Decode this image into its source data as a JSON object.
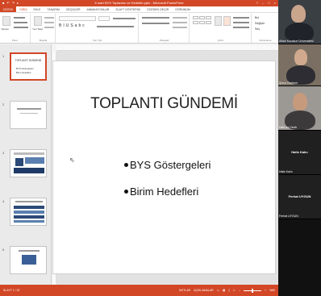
{
  "app": {
    "title": "6 mart BYS Toplantısı ve Hedefler.pptx - Microsoft PowerPoint",
    "qat_icons": [
      "save-icon",
      "undo-icon",
      "redo-icon",
      "start-icon"
    ],
    "window_controls": [
      "?",
      "–",
      "□",
      "×"
    ]
  },
  "ribbon": {
    "tabs": [
      "DOSYA",
      "GİRİŞ",
      "EKLE",
      "TASARIM",
      "GEÇİŞLER",
      "ANİMASYONLAR",
      "SLAYT GÖSTERİSİ",
      "GÖZDEN GEÇİR",
      "GÖRÜNÜM"
    ],
    "active_tab": "GİRİŞ",
    "groups": [
      "Pano",
      "Slaytlar",
      "Yazı Tipi",
      "Paragraf",
      "Çizim",
      "Düzenleme"
    ],
    "paste_label": "Yapıştır",
    "new_slide_label": "Yeni Slayt",
    "find_label": "Bul",
    "replace_label": "Değiştir",
    "select_label": "Seç"
  },
  "thumbnails": [
    {
      "number": "1",
      "title": "TOPLANTI GÜNDEMİ",
      "lines": [
        "BYS Göstergeleri",
        "Birim Hedefleri"
      ]
    },
    {
      "number": "2",
      "title": ""
    },
    {
      "number": "3",
      "title": ""
    },
    {
      "number": "4",
      "title": ""
    },
    {
      "number": "5",
      "title": ""
    }
  ],
  "slide": {
    "title": "TOPLANTI GÜNDEMİ",
    "bullets": [
      "BYS Göstergeleri",
      "Birim Hedefleri"
    ]
  },
  "status": {
    "left": "SLAYT 1 / 22",
    "notes": "NOTLAR",
    "comments": "AÇIKLAMALAR",
    "zoom": "%60"
  },
  "participants": [
    {
      "name": "Alkan Kocakurt Üniversitesi",
      "type": "video",
      "initials": ""
    },
    {
      "name": "Şenol Özdemir",
      "type": "video",
      "initials": ""
    },
    {
      "name": "Halil İbn Yenik",
      "type": "video",
      "initials": ""
    },
    {
      "name": "Halis Kalın",
      "type": "name",
      "initials": "Halis Kalın"
    },
    {
      "name": "Ferhat UYGUN",
      "type": "name",
      "initials": "Ferhat UYGUN"
    }
  ],
  "colors": {
    "accent": "#d24726",
    "participant_bg": "#111111"
  }
}
